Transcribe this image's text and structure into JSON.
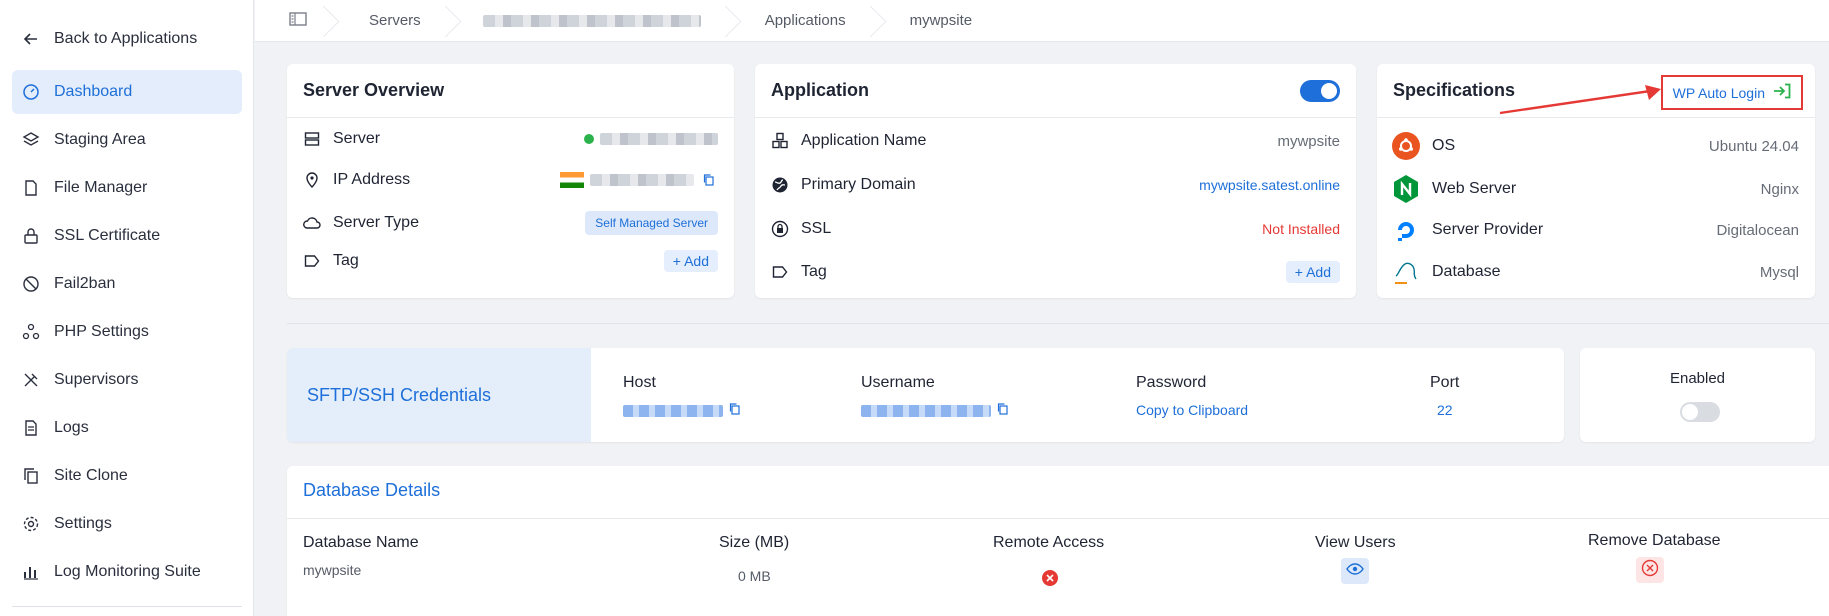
{
  "sidebar": {
    "back_label": "Back to Applications",
    "items": [
      {
        "label": "Dashboard",
        "icon": "dashboard-icon",
        "active": true
      },
      {
        "label": "Staging Area",
        "icon": "layers-icon"
      },
      {
        "label": "File Manager",
        "icon": "file-icon"
      },
      {
        "label": "SSL Certificate",
        "icon": "lock-icon"
      },
      {
        "label": "Fail2ban",
        "icon": "ban-icon"
      },
      {
        "label": "PHP Settings",
        "icon": "nodes-icon"
      },
      {
        "label": "Supervisors",
        "icon": "tools-icon"
      },
      {
        "label": "Logs",
        "icon": "document-icon"
      },
      {
        "label": "Site Clone",
        "icon": "copy-icon"
      },
      {
        "label": "Settings",
        "icon": "gear-icon"
      },
      {
        "label": "Log Monitoring Suite",
        "icon": "bar-chart-icon"
      }
    ]
  },
  "breadcrumb": {
    "servers": "Servers",
    "applications": "Applications",
    "current": "mywpsite"
  },
  "server_overview": {
    "title": "Server Overview",
    "server_label": "Server",
    "ip_label": "IP Address",
    "type_label": "Server Type",
    "type_value": "Self Managed Server",
    "tag_label": "Tag",
    "add_label": "+ Add"
  },
  "application": {
    "title": "Application",
    "name_label": "Application Name",
    "name_value": "mywpsite",
    "domain_label": "Primary Domain",
    "domain_value": "mywpsite.satest.online",
    "ssl_label": "SSL",
    "ssl_value": "Not Installed",
    "tag_label": "Tag",
    "add_label": "+ Add",
    "enabled": true
  },
  "specifications": {
    "title": "Specifications",
    "wp_auto_login": "WP Auto Login",
    "os_label": "OS",
    "os_value": "Ubuntu 24.04",
    "web_label": "Web Server",
    "web_value": "Nginx",
    "provider_label": "Server Provider",
    "provider_value": "Digitalocean",
    "db_label": "Database",
    "db_value": "Mysql"
  },
  "sftp": {
    "title": "SFTP/SSH Credentials",
    "host_label": "Host",
    "username_label": "Username",
    "password_label": "Password",
    "password_value": "Copy to Clipboard",
    "port_label": "Port",
    "port_value": "22",
    "enabled_label": "Enabled",
    "enabled": false
  },
  "database": {
    "title": "Database Details",
    "columns": [
      "Database Name",
      "Size (MB)",
      "Remote Access",
      "View Users",
      "Remove Database"
    ],
    "rows": [
      {
        "name": "mywpsite",
        "size": "0 MB"
      }
    ]
  },
  "colors": {
    "accent": "#1e6fd9",
    "danger": "#e53935",
    "success": "#2bb24c"
  }
}
